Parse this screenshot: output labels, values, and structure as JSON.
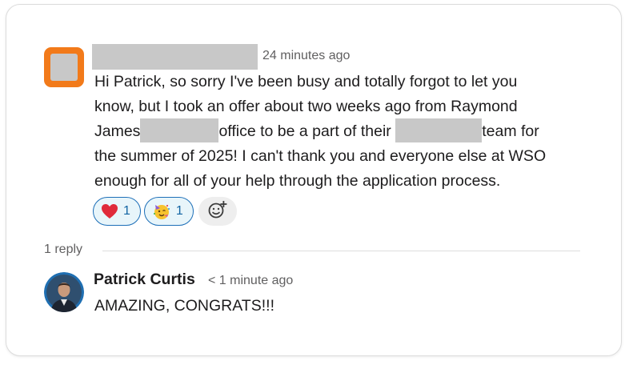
{
  "message": {
    "timestamp": "24 minutes ago",
    "lines": [
      {
        "text": "Hi Patrick, so sorry I've been busy and totally forgot to let you"
      },
      {
        "text": "know, but I took an offer about two weeks ago from Raymond"
      },
      {
        "before": "James",
        "middle": "office to be a part of their",
        "after": "team for"
      },
      {
        "text": "the summer of 2025! I can't thank you and everyone else at WSO"
      },
      {
        "text": "enough for all of your help through the application process."
      }
    ],
    "reactions": [
      {
        "icon": "red-heart-icon",
        "count": "1"
      },
      {
        "icon": "partying-face-icon",
        "count": "1"
      }
    ]
  },
  "thread": {
    "reply_count_label": "1 reply"
  },
  "reply": {
    "author": "Patrick Curtis",
    "timestamp": "< 1 minute ago",
    "text": "AMAZING, CONGRATS!!!"
  },
  "colors": {
    "avatar_border": "#f27a1a",
    "redaction": "#c8c8c8",
    "reaction_border": "#1d6fb8",
    "reaction_bg": "#e8f5fa",
    "reaction_text": "#1264a3",
    "muted_text": "#616061",
    "body_text": "#1d1c1d"
  }
}
